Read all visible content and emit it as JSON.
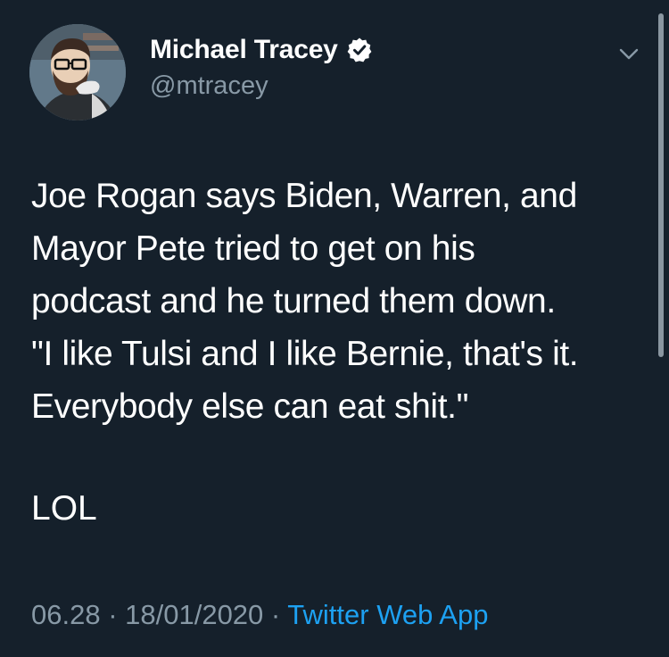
{
  "author": {
    "display_name": "Michael Tracey",
    "handle": "@mtracey",
    "verified": true,
    "avatar_icon": "avatar-illustration"
  },
  "tweet": {
    "lines": [
      "Joe Rogan says Biden, Warren, and",
      "Mayor Pete tried to get on his",
      "podcast and he turned them down.",
      "\"I like Tulsi and I like Bernie, that's it.",
      "Everybody else can eat shit.\""
    ],
    "followup": "LOL"
  },
  "meta": {
    "time": "06.28",
    "separator1": " · ",
    "date": "18/01/2020",
    "separator2": " · ",
    "source": "Twitter Web App"
  },
  "colors": {
    "background": "#15202b",
    "secondary_text": "#8899a6",
    "link": "#1da1f2"
  },
  "icons": {
    "verified": "verified-badge-icon",
    "menu": "chevron-down-icon"
  }
}
